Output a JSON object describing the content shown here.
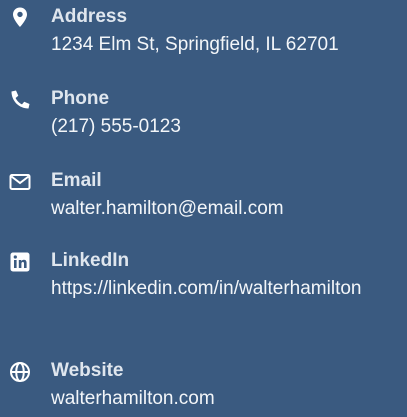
{
  "theme": {
    "background": "#3a5a80",
    "label_color": "#dfe6ee",
    "value_color": "#f3f6f9",
    "icon_color": "#ffffff"
  },
  "contact": {
    "address": {
      "icon": "map-marker-icon",
      "label": "Address",
      "value": "1234 Elm St, Springfield, IL 62701"
    },
    "phone": {
      "icon": "phone-icon",
      "label": "Phone",
      "value": "(217) 555-0123"
    },
    "email": {
      "icon": "envelope-icon",
      "label": "Email",
      "value": "walter.hamilton@email.com"
    },
    "linkedin": {
      "icon": "linkedin-icon",
      "label": "LinkedIn",
      "value": "https://linkedin.com/in/walterhamilton"
    },
    "website": {
      "icon": "globe-icon",
      "label": "Website",
      "value": "walterhamilton.com"
    }
  }
}
